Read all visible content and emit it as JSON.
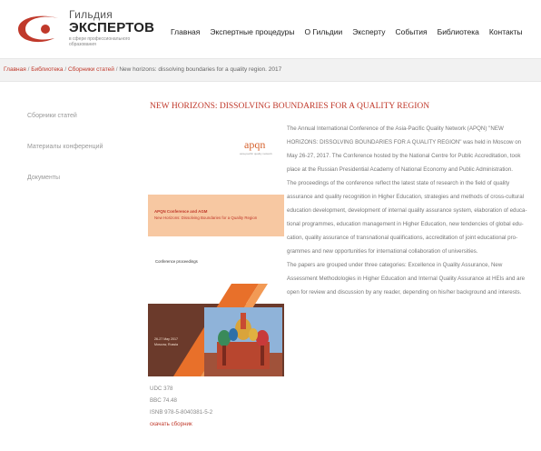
{
  "logo": {
    "line1": "Гильдия",
    "line2": "ЭКСПЕРТОВ",
    "line3": "в сфере профессионального образования"
  },
  "nav": {
    "items": [
      "Главная",
      "Экспертные процедуры",
      "О Гильдии",
      "Эксперту",
      "События",
      "Библиотека",
      "Контакты"
    ]
  },
  "breadcrumb": {
    "home": "Главная",
    "library": "Библиотека",
    "collections": "Сборники статей",
    "current": "New horizons: dissolving boundaries for a quality region. 2017",
    "separator": "/"
  },
  "sidebar": {
    "items": [
      "Сборники статей",
      "Материалы конференций",
      "Документы"
    ]
  },
  "article": {
    "title": "NEW HORIZONS: DISSOLVING BOUNDARIES FOR A QUALITY REGION",
    "paragraphs": [
      "The Annual International Conference of the Asia-Pacific Quality Network (APQN) \"NEW HORIZONS: DISSOLVING BOUNDARIES FOR A QUALITY REGION\" was held in Moscow on May 26-27, 2017. The Conference hosted by the National Centre for Public Accreditation, took place at the Russian Presidential Academy of National Economy and Public Administration.",
      "The proceedings of the conference reflect the latest state of research in the field of quality assurance and quality recognition in Higher Education, strategies and methods of cross-cultural education development, development of internal quality assurance system, elaboration of educa-tional programmes, education management in Higher Education, new tendencies of global edu-cation, quality assurance of transnational qualifications, accreditation of joint educational pro-grammes and new opportunities for international collaboration of universities.",
      "The papers are grouped under three categories: Excellence in Quality Assurance, New Assessment Methodologies in Higher Education and Internal Quality Assurance at HEIs and are open for review and discussion by any reader, depending on his/her background and interests."
    ]
  },
  "book_cover": {
    "brand": "apqn",
    "brand_sub": "asia-pacific quality network",
    "heading": "APQN Conference and AGM",
    "subheading": "New Horizons: Dissolving Boundaries for a Quality Region",
    "proceedings": "Conference proceedings",
    "date": "26-27 May 2017",
    "city": "Moscow, Russia"
  },
  "meta": {
    "udc": "UDC 378",
    "bbc": "BBC 74.48",
    "isbn": "ISNB 978-5-8040381-5-2",
    "download": "скачать сборник"
  },
  "colors": {
    "accent": "#c0392b",
    "band": "#f7c8a2",
    "stripe": "#e8702a",
    "cover_dark": "#6b3a2b"
  }
}
